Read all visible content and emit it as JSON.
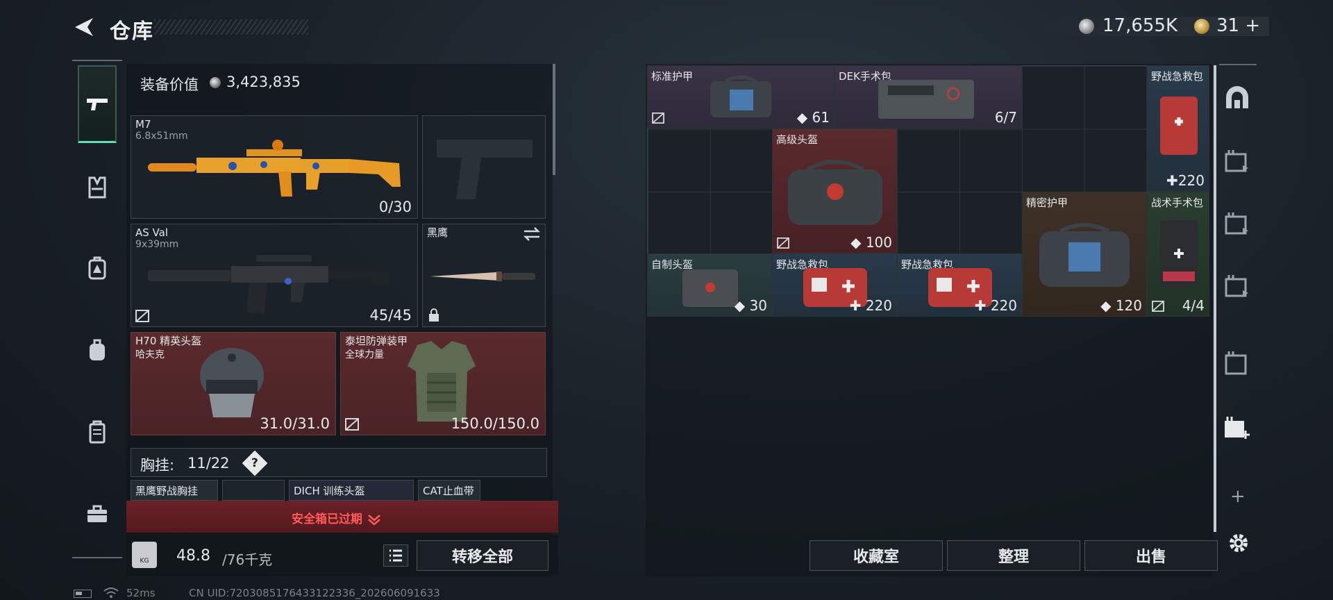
{
  "header": {
    "title": "仓库",
    "silver": "17,655K",
    "gold": "31",
    "gold_plus": "+"
  },
  "left_tabs": [
    "weapon",
    "vest",
    "backpack-armor",
    "backpack",
    "case",
    "toolbox"
  ],
  "equipment": {
    "value_label": "装备价值",
    "value": "3,423,835",
    "primary": {
      "name": "M7",
      "caliber": "6.8x51mm",
      "ammo": "0/30"
    },
    "secondary": {
      "name": "AS Val",
      "caliber": "9x39mm",
      "ammo": "45/45"
    },
    "knife": {
      "name": "黑鹰"
    },
    "helmet": {
      "name": "H70 精英头盔",
      "sub": "哈夫克",
      "durability": "31.0/31.0"
    },
    "armor": {
      "name": "泰坦防弹装甲",
      "sub": "全球力量",
      "durability": "150.0/150.0"
    }
  },
  "chest_rig": {
    "label": "胸挂:",
    "count": "11/22",
    "help": "?",
    "items": [
      "黑鹰野战胸挂",
      "",
      "DICH 训练头盔",
      "CAT止血带"
    ]
  },
  "expired_text": "安全箱已过期",
  "weight": {
    "value": "48.8",
    "max": "/76千克"
  },
  "transfer_label": "转移全部",
  "status": {
    "ping": "52ms",
    "uid": "CN UID:7203085176433122336_202606091633"
  },
  "storage_items": [
    {
      "id": "armor1",
      "name": "标准护甲",
      "value": "61",
      "icon": "shield"
    },
    {
      "id": "dek",
      "name": "DEK手术包",
      "value": "6/7",
      "icon": ""
    },
    {
      "id": "medkit1",
      "name": "野战急救包",
      "value": "220",
      "icon": "plus"
    },
    {
      "id": "helmet-adv",
      "name": "高级头盔",
      "value": "100",
      "icon": "shield"
    },
    {
      "id": "armor-precise",
      "name": "精密护甲",
      "value": "120",
      "icon": "shield"
    },
    {
      "id": "surgery",
      "name": "战术手术包",
      "value": "4/4",
      "icon": ""
    },
    {
      "id": "helmet-diy",
      "name": "自制头盔",
      "value": "30",
      "icon": "shield"
    },
    {
      "id": "medkit2",
      "name": "野战急救包",
      "value": "220",
      "icon": "plus"
    },
    {
      "id": "medkit3",
      "name": "野战急救包",
      "value": "220",
      "icon": "plus"
    }
  ],
  "buttons": {
    "collection": "收藏室",
    "sort": "整理",
    "sell": "出售"
  },
  "colors": {
    "accent": "#5fe0b0",
    "expired": "#ff5a5a",
    "red_slot": "#5a2a2d"
  }
}
